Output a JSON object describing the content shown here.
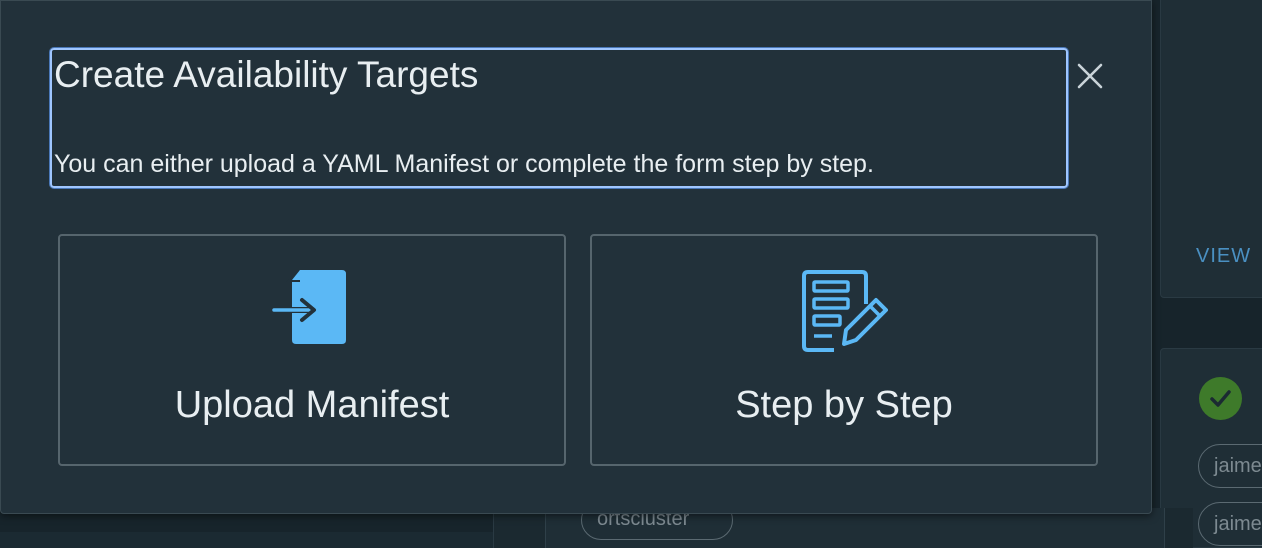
{
  "modal": {
    "title": "Create Availability Targets",
    "subtitle": "You can either upload a YAML Manifest or complete the form step by step.",
    "close_icon": "close-icon",
    "options": [
      {
        "label": "Upload Manifest",
        "icon": "upload-file-icon"
      },
      {
        "label": "Step by Step",
        "icon": "form-edit-icon"
      }
    ]
  },
  "background": {
    "view_link": "VIEW",
    "pills": [
      "jaime",
      "jaime",
      "ortscluster"
    ],
    "status_icon": "check-circle-icon"
  },
  "colors": {
    "accent": "#5bb8f5",
    "focus_outline": "#9fc6ff",
    "modal_bg": "#22313a",
    "success": "#3e7a2a"
  }
}
